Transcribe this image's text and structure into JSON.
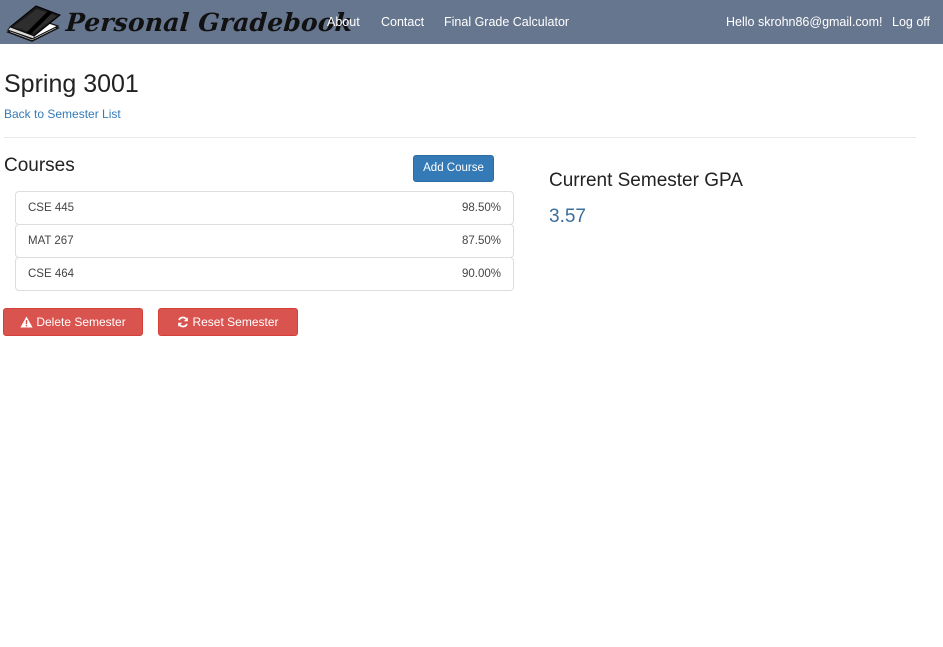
{
  "nav": {
    "brand": "Personal Gradebook",
    "links": [
      "About",
      "Contact",
      "Final Grade Calculator"
    ],
    "greeting": "Hello skrohn86@gmail.com!",
    "logoff": "Log off"
  },
  "page": {
    "title": "Spring 3001",
    "back_link": "Back to Semester List"
  },
  "courses": {
    "heading": "Courses",
    "add_label": "Add Course",
    "items": [
      {
        "name": "CSE 445",
        "grade": "98.50%"
      },
      {
        "name": "MAT 267",
        "grade": "87.50%"
      },
      {
        "name": "CSE 464",
        "grade": "90.00%"
      }
    ]
  },
  "actions": {
    "delete_label": "Delete Semester",
    "reset_label": "Reset Semester",
    "delete_icon": "warning-icon",
    "reset_icon": "refresh-icon"
  },
  "gpa": {
    "heading": "Current Semester GPA",
    "value": "3.57"
  },
  "colors": {
    "navbar": "#67768f",
    "primary": "#337ab7",
    "danger": "#d9534f",
    "gpa": "#3a6f9c"
  }
}
